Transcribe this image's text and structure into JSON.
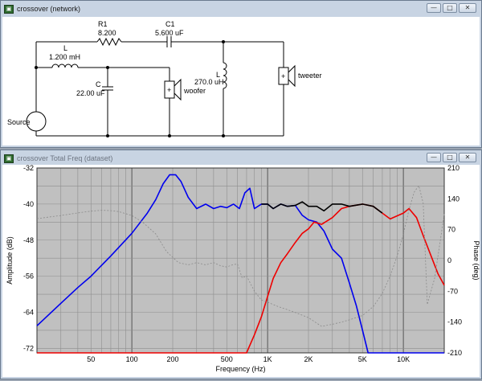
{
  "network_window": {
    "title": "crossover (network)",
    "buttons": {
      "minimize": "—",
      "maximize": "□",
      "close": "✕"
    },
    "components": {
      "r1": {
        "name": "R1",
        "value": "8.200"
      },
      "c1": {
        "name": "C1",
        "value": "5.600 uF"
      },
      "l_series": {
        "name": "L",
        "value": "1.200 mH"
      },
      "c_shunt": {
        "name": "C",
        "value": "22.00 uF"
      },
      "l_shunt": {
        "name": "L",
        "value": "270.0 uH"
      },
      "woofer": {
        "label": "woofer"
      },
      "tweeter": {
        "label": "tweeter"
      },
      "source": {
        "label": "Source"
      }
    }
  },
  "freq_window": {
    "title": "crossover Total Freq (dataset)",
    "buttons": {
      "minimize": "—",
      "maximize": "□",
      "close": "✕"
    }
  },
  "chart_data": {
    "type": "line",
    "xlabel": "Frequency (Hz)",
    "ylabel_left": "Amplitude (dB)",
    "ylabel_right": "Phase (deg)",
    "x_scale": "log",
    "xlim": [
      20,
      20000
    ],
    "ylim_left": [
      -73,
      -32
    ],
    "ylim_right": [
      -210,
      210
    ],
    "x_ticks": [
      50,
      100,
      200,
      500,
      1000,
      2000,
      5000,
      10000
    ],
    "x_tick_labels": [
      "50",
      "100",
      "200",
      "500",
      "1K",
      "2K",
      "5K",
      "10K"
    ],
    "y_ticks_left": [
      -32,
      -40,
      -48,
      -56,
      -64,
      -72
    ],
    "y_tick_labels_left": [
      "-32",
      "-40",
      "-48",
      "-56",
      "-64",
      "-72"
    ],
    "y_ticks_right": [
      210,
      140,
      70,
      0,
      -70,
      -140,
      -210
    ],
    "y_tick_labels_right": [
      "210",
      "140",
      "70",
      "0",
      "-70",
      "-140",
      "-210"
    ],
    "grid": true,
    "series": [
      {
        "color": "#0000ee",
        "axis": "left",
        "x": [
          20,
          30,
          40,
          50,
          70,
          100,
          130,
          150,
          170,
          190,
          210,
          230,
          260,
          300,
          350,
          400,
          450,
          500,
          560,
          620,
          680,
          740,
          800,
          900,
          1000,
          1100,
          1250,
          1400,
          1600,
          1800,
          2000,
          2300,
          2600,
          3000,
          3500,
          4000,
          4500,
          5000,
          5500,
          6000,
          7000,
          8000,
          10000,
          15000,
          20000
        ],
        "values": [
          -67,
          -62,
          -58.5,
          -56,
          -51.5,
          -46.5,
          -42,
          -39,
          -35.5,
          -33.5,
          -33.5,
          -35,
          -38.5,
          -41,
          -40,
          -41,
          -40.5,
          -40.8,
          -40,
          -41,
          -37.5,
          -36.5,
          -41,
          -40,
          -40,
          -41,
          -40,
          -40.5,
          -40.3,
          -42.5,
          -43.5,
          -44,
          -46,
          -50,
          -52,
          -57.5,
          -62.5,
          -68,
          -73,
          -73,
          -73,
          -73,
          -73,
          -73,
          -73
        ]
      },
      {
        "color": "#ee0000",
        "axis": "left",
        "x": [
          20,
          100,
          500,
          700,
          800,
          900,
          1000,
          1100,
          1250,
          1400,
          1600,
          1800,
          2000,
          2200,
          2500,
          3000,
          3500,
          4000,
          5000,
          6000,
          7000,
          8000,
          10000,
          11000,
          12500,
          14000,
          16000,
          18000,
          20000
        ],
        "values": [
          -73,
          -73,
          -73,
          -73,
          -69,
          -65,
          -60.5,
          -56.5,
          -53,
          -51,
          -48.5,
          -46.5,
          -45.5,
          -44,
          -44.5,
          -43,
          -41,
          -40.5,
          -40,
          -40.5,
          -42,
          -43.3,
          -42,
          -41,
          -43,
          -47,
          -51.5,
          -55.5,
          -58
        ]
      },
      {
        "color": "#000000",
        "axis": "left",
        "x": [
          900,
          1000,
          1100,
          1250,
          1400,
          1600,
          1800,
          2000,
          2300,
          2600,
          3000,
          3500,
          4000,
          5000,
          6000,
          7000
        ],
        "values": [
          -40,
          -40,
          -41,
          -40,
          -40.5,
          -40.3,
          -39.5,
          -40.5,
          -40.5,
          -41.5,
          -40,
          -40,
          -40.5,
          -40,
          -40.5,
          -42
        ]
      },
      {
        "color": "#8a8a8a",
        "axis": "right",
        "dashed": true,
        "x": [
          20,
          30,
          40,
          50,
          60,
          70,
          80,
          100,
          120,
          150,
          180,
          220,
          260,
          300,
          350,
          400,
          450,
          500,
          550,
          600,
          650,
          700,
          800,
          900,
          1000,
          1200,
          1500,
          2000,
          2500,
          3000,
          3500,
          4000,
          5000,
          6000,
          7000,
          8000,
          9000,
          10000,
          11000,
          12000,
          13000,
          14000,
          15000,
          17000,
          20000
        ],
        "values": [
          95,
          102,
          108,
          112,
          114,
          113,
          111,
          102,
          87,
          60,
          20,
          -5,
          -10,
          -5,
          -10,
          -5,
          -12,
          -15,
          -10,
          -8,
          -40,
          -35,
          -70,
          -90,
          -95,
          -105,
          -115,
          -130,
          -150,
          -145,
          -140,
          -135,
          -125,
          -105,
          -75,
          -35,
          10,
          60,
          115,
          155,
          170,
          130,
          -100,
          -40,
          105
        ]
      }
    ]
  }
}
